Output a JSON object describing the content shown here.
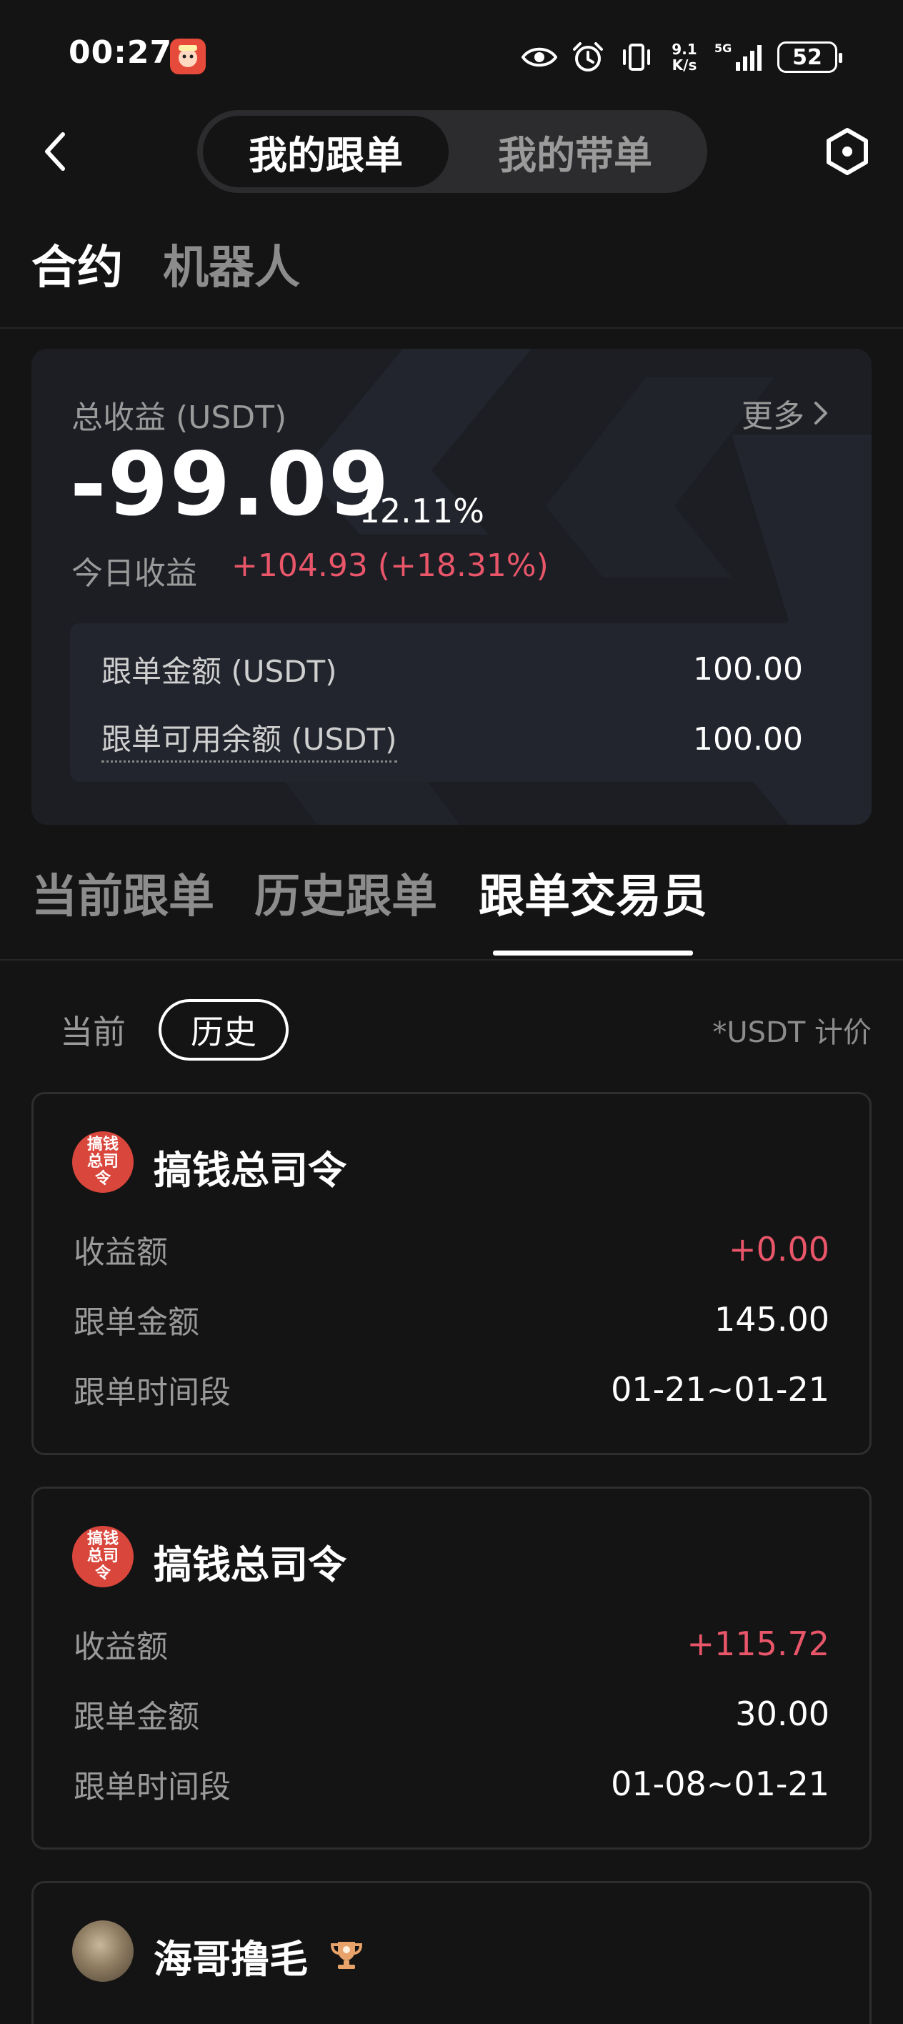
{
  "status_bar": {
    "time": "00:27",
    "app_badge_text": "搞钱",
    "net_speed_value": "9.1",
    "net_speed_unit": "K/s",
    "network": "5G",
    "battery": "52"
  },
  "header": {
    "segments": [
      "我的跟单",
      "我的带单"
    ],
    "active_segment": "我的跟单"
  },
  "category_tabs": [
    "合约",
    "机器人"
  ],
  "summary": {
    "total_label": "总收益 (USDT)",
    "more_label": "更多",
    "total_value": "-99.09",
    "total_percent": "-12.11%",
    "today_label": "今日收益",
    "today_value": "+104.93 (+18.31%)",
    "rows": [
      {
        "label": "跟单金额 (USDT)",
        "value": "100.00"
      },
      {
        "label": "跟单可用余额 (USDT)",
        "value": "100.00"
      }
    ]
  },
  "main_tabs": [
    "当前跟单",
    "历史跟单",
    "跟单交易员"
  ],
  "active_main_tab": "跟单交易员",
  "filter": {
    "current_label": "当前",
    "history_label": "历史",
    "pricing_note": "*USDT 计价"
  },
  "row_labels": {
    "profit": "收益额",
    "amount": "跟单金额",
    "period": "跟单时间段"
  },
  "traders": [
    {
      "avatar_text": "搞钱总司令",
      "name": "搞钱总司令",
      "profit": "+0.00",
      "amount": "145.00",
      "period": "01-21~01-21"
    },
    {
      "avatar_text": "搞钱总司令",
      "name": "搞钱总司令",
      "profit": "+115.72",
      "amount": "30.00",
      "period": "01-08~01-21"
    },
    {
      "name": "海哥撸毛"
    }
  ],
  "colors": {
    "background": "#141414",
    "card": "#1c1e24",
    "positive": "#e9566a",
    "muted": "#9a9a9a",
    "avatar_red": "#d9463c"
  }
}
